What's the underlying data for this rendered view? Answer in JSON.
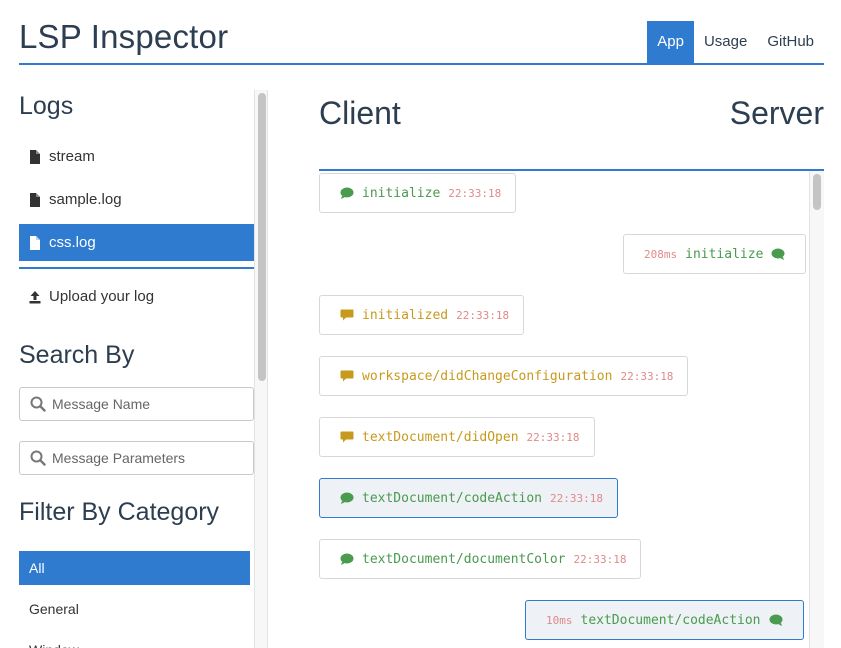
{
  "app": {
    "title": "LSP Inspector"
  },
  "nav": {
    "tabs": [
      {
        "label": "App"
      },
      {
        "label": "Usage"
      },
      {
        "label": "GitHub"
      }
    ]
  },
  "sidebar": {
    "logs_title": "Logs",
    "logs": [
      {
        "label": "stream"
      },
      {
        "label": "sample.log"
      },
      {
        "label": "css.log"
      }
    ],
    "upload_label": "Upload your log",
    "search_title": "Search By",
    "search_name_placeholder": "Message Name",
    "search_params_placeholder": "Message Parameters",
    "filter_title": "Filter By Category",
    "categories": [
      {
        "label": "All"
      },
      {
        "label": "General"
      },
      {
        "label": "Window"
      }
    ]
  },
  "main": {
    "client_label": "Client",
    "server_label": "Server",
    "messages": [
      {
        "name": "initialize",
        "time": "22:33:18",
        "side": "client",
        "kind": "request"
      },
      {
        "name": "initialize",
        "duration": "208ms",
        "side": "server",
        "kind": "response"
      },
      {
        "name": "initialized",
        "time": "22:33:18",
        "side": "client",
        "kind": "notification"
      },
      {
        "name": "workspace/didChangeConfiguration",
        "time": "22:33:18",
        "side": "client",
        "kind": "notification"
      },
      {
        "name": "textDocument/didOpen",
        "time": "22:33:18",
        "side": "client",
        "kind": "notification"
      },
      {
        "name": "textDocument/codeAction",
        "time": "22:33:18",
        "side": "client",
        "kind": "request",
        "selected": true
      },
      {
        "name": "textDocument/documentColor",
        "time": "22:33:18",
        "side": "client",
        "kind": "request"
      },
      {
        "name": "textDocument/codeAction",
        "duration": "10ms",
        "side": "server",
        "kind": "response",
        "selected": true
      }
    ]
  },
  "colors": {
    "accent": "#2f7bd0",
    "request": "#4a9a4f",
    "notification": "#c79a1e",
    "time": "#e08a8a",
    "title": "#2c3e50"
  },
  "icons": {
    "log": "file-icon",
    "upload": "upload-icon",
    "search": "search-icon",
    "message": "chat-bubble-icon"
  }
}
